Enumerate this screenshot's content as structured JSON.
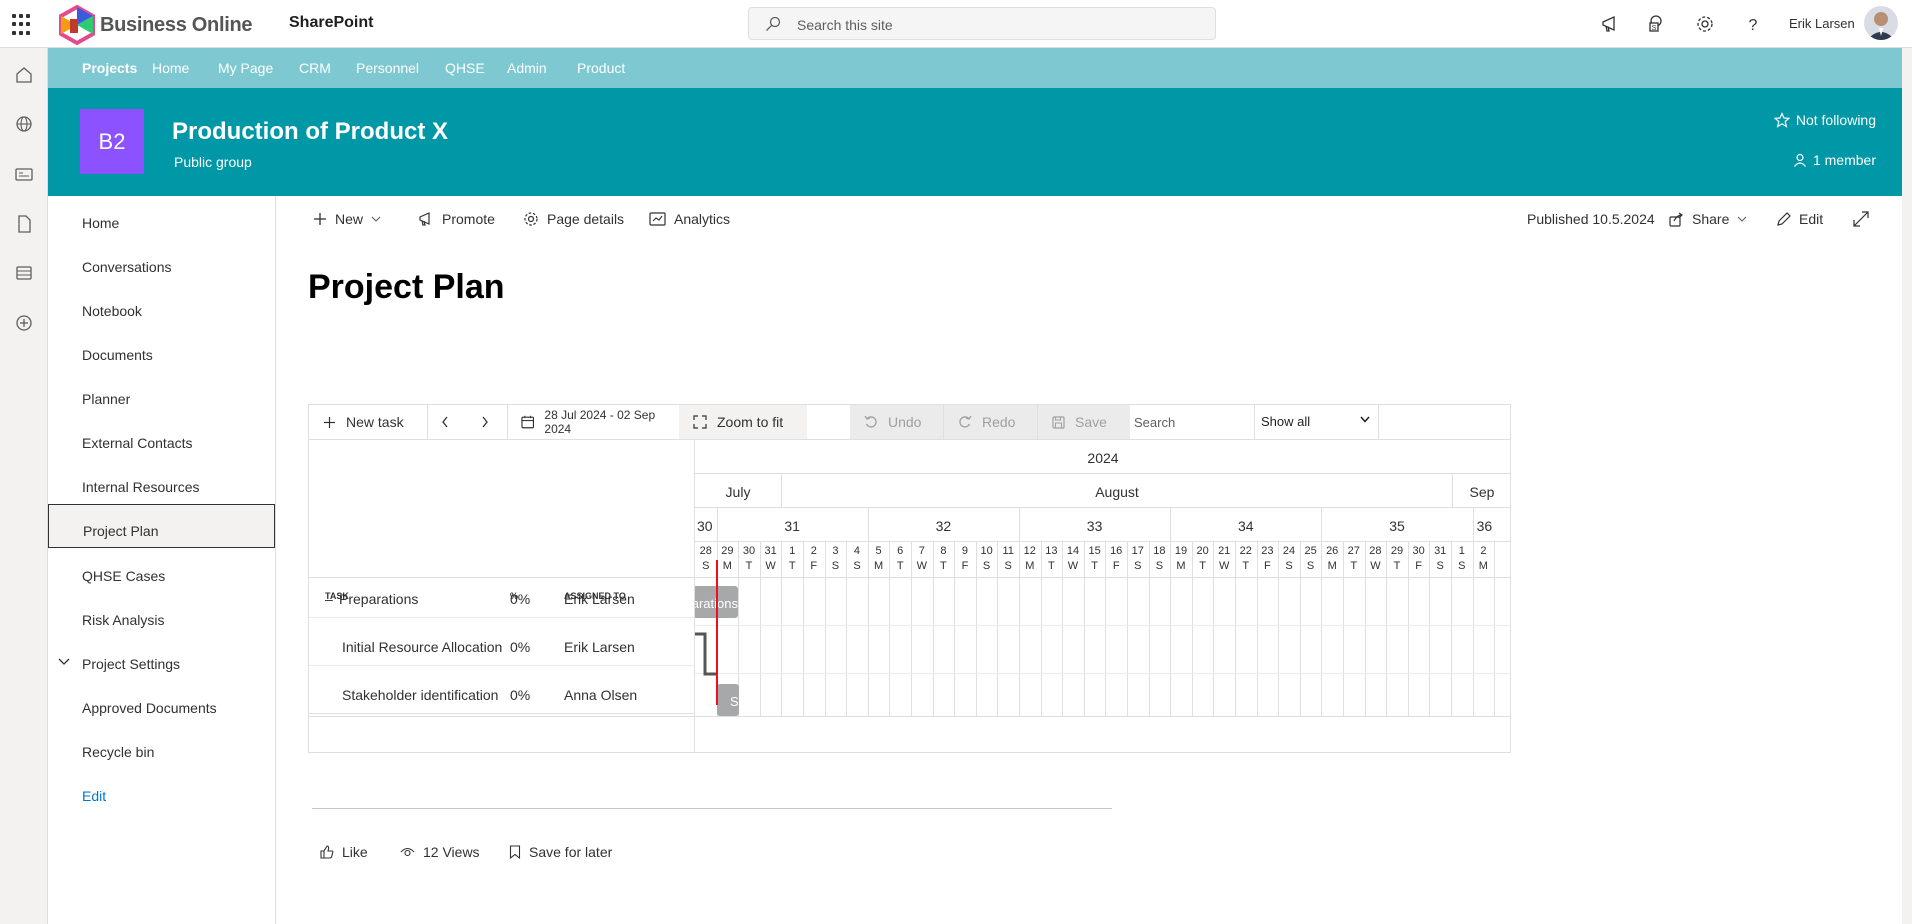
{
  "topbar": {
    "brand": "Business Online",
    "site_app": "SharePoint",
    "search_placeholder": "Search this site",
    "user_name": "Erik Larsen"
  },
  "hubnav": {
    "items": [
      "Projects",
      "Home",
      "My Page",
      "CRM",
      "Personnel",
      "QHSE",
      "Admin",
      "Product"
    ]
  },
  "site": {
    "logo_text": "B2",
    "title": "Production of Product X",
    "subtitle": "Public group",
    "follow_label": "Not following",
    "members_label": "1 member",
    "header_color": "#0097a7",
    "logo_color": "#8c52ff"
  },
  "quicknav": {
    "items": [
      "Home",
      "Conversations",
      "Notebook",
      "Documents",
      "Planner",
      "External Contacts",
      "Internal Resources",
      "Project Plan",
      "QHSE Cases",
      "Risk Analysis",
      "Project Settings",
      "Approved Documents",
      "Recycle bin"
    ],
    "active": "Project Plan",
    "edit_label": "Edit"
  },
  "commandbar": {
    "new": "New",
    "promote": "Promote",
    "page_details": "Page details",
    "analytics": "Analytics",
    "published": "Published 10.5.2024",
    "share": "Share",
    "edit": "Edit"
  },
  "page": {
    "title": "Project Plan"
  },
  "gantt": {
    "toolbar": {
      "new_task": "New task",
      "date_range": "28 Jul 2024 - 02 Sep 2024",
      "zoom": "Zoom to fit",
      "undo": "Undo",
      "redo": "Redo",
      "save": "Save",
      "search_placeholder": "Search",
      "filter_value": "Show all"
    },
    "columns": {
      "task": "TASK",
      "percent": "%",
      "assigned": "ASSIGNED TO"
    },
    "tasks": [
      {
        "name": "Preparations",
        "prefix": "–",
        "percent": "0%",
        "assigned": "Erik Larsen",
        "bar_label": "Preparations"
      },
      {
        "name": "Initial Resource Allocation",
        "prefix": "",
        "percent": "0%",
        "assigned": "Erik Larsen",
        "bar_label": ""
      },
      {
        "name": "Stakeholder identification",
        "prefix": "",
        "percent": "0%",
        "assigned": "Anna Olsen",
        "bar_label": "S"
      }
    ],
    "year": "2024",
    "months": [
      "July",
      "August",
      "Sep"
    ],
    "weeks": [
      "30",
      "31",
      "32",
      "33",
      "34",
      "35",
      "36"
    ],
    "days": [
      "28",
      "29",
      "30",
      "31",
      "1",
      "2",
      "3",
      "4",
      "5",
      "6",
      "7",
      "8",
      "9",
      "10",
      "11",
      "12",
      "13",
      "14",
      "15",
      "16",
      "17",
      "18",
      "19",
      "20",
      "21",
      "22",
      "23",
      "24",
      "25",
      "26",
      "27",
      "28",
      "29",
      "30",
      "31",
      "1",
      "2"
    ],
    "weekdays": [
      "S",
      "M",
      "T",
      "W",
      "T",
      "F",
      "S",
      "S",
      "M",
      "T",
      "W",
      "T",
      "F",
      "S",
      "S",
      "M",
      "T",
      "W",
      "T",
      "F",
      "S",
      "S",
      "M",
      "T",
      "W",
      "T",
      "F",
      "S",
      "S",
      "M",
      "T",
      "W",
      "T",
      "F",
      "S",
      "S",
      "M"
    ]
  },
  "footer": {
    "like": "Like",
    "views": "12 Views",
    "save_later": "Save for later"
  }
}
